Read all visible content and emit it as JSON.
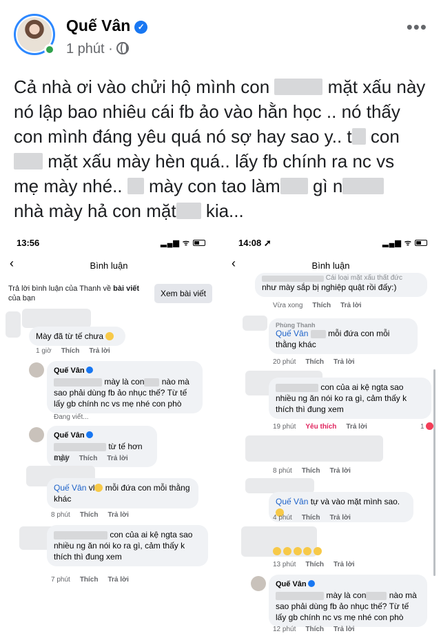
{
  "post": {
    "author": "Quế Vân",
    "time": "1 phút",
    "text_lines": [
      [
        "Cả nhà ơi vào chửi hộ mình con ",
        "mặt xấu này"
      ],
      [
        "nó lập bao nhiêu cái fb ảo vào hằn học .. nó thấy"
      ],
      [
        "con mình đáng yêu quá nó sợ hay sao y.. t",
        "con"
      ],
      [
        "mặt xấu mày hèn quá.. lấy fb chính ra nc vs"
      ],
      [
        "mẹ mày nhé.. ",
        "mày con tao làm",
        "gì n"
      ],
      [
        "nhà mày hả con mặt",
        "kia..."
      ]
    ]
  },
  "left_phone": {
    "time": "13:56",
    "nav_title": "Bình luận",
    "reply_banner": {
      "prefix": "Trả lời bình luận của Thanh về ",
      "bold": "bài viết",
      "suffix": " của bạn"
    },
    "view_post_label": "Xem bài viết",
    "comments": [
      {
        "name": "",
        "text": "Mày đã từ tế chưa",
        "time": "1 giờ",
        "like": "Thích",
        "reply": "Trả lời"
      },
      {
        "name": "Quế Vân",
        "text1": "mày là con",
        "text2": "nào mà sao phải dùng fb ảo nhục thế? Từ tế lấy gb chính nc vs mẹ nhé con phò",
        "time": "Đang viết..."
      },
      {
        "name": "Quế Vân",
        "text": "từ tế hơn mày",
        "time": "1 giờ",
        "like": "Thích",
        "reply": "Trả lời"
      },
      {
        "name": "",
        "tag": "Quế Vân",
        "text": "vl",
        "text2": "mỗi đứa con mỗi thằng khác",
        "time": "8 phút",
        "like": "Thích",
        "reply": "Trả lời"
      },
      {
        "name": "",
        "text": "con của ai kệ ngta sao nhiều ng ăn nói ko ra gì, cảm thấy k thích thì đung xem",
        "time": "7 phút",
        "like": "Thích",
        "reply": "Trả lời"
      }
    ]
  },
  "right_phone": {
    "time": "14:08",
    "nav_title": "Bình luận",
    "comments": [
      {
        "text_top": "Cái loại mặt xấu thất đức",
        "text": "như mày sắp bị nghiệp quật rồi đấy:)",
        "time": "Vừa xong",
        "like": "Thích",
        "reply": "Trả lời"
      },
      {
        "name": "Phùng Thanh",
        "tag": "Quế Vân",
        "text": "mỗi đứa con mỗi thằng khác",
        "time": "20 phút",
        "like": "Thích",
        "reply": "Trả lời"
      },
      {
        "text": "con của ai kệ ngta sao nhiều ng ăn nói ko ra gì, cảm thấy k thích thì đung xem",
        "time": "19 phút",
        "like": "Yêu thích",
        "reply": "Trả lời",
        "reactions": "1"
      },
      {
        "time": "8 phút",
        "like": "Thích",
        "reply": "Trả lời"
      },
      {
        "tag": "Quế Vân",
        "text": "tự và vào mặt mình sao.",
        "time": "4 phút",
        "like": "Thích",
        "reply": "Trả lời"
      },
      {
        "time": "13 phút",
        "like": "Thích",
        "reply": "Trả lời"
      },
      {
        "name": "Quế Vân",
        "text1": "mày là con",
        "text2": "nào mà sao phải dùng fb ảo nhục thế? Từ tế lấy gb chính nc vs mẹ nhé con phò",
        "time": "12 phút",
        "like": "Thích",
        "reply": "Trả lời"
      }
    ]
  },
  "colors": {
    "verified": "#1877f2",
    "online": "#31a24c",
    "link": "#1d62c9",
    "liked": "#e0245e",
    "bubble": "#f0f2f5"
  }
}
